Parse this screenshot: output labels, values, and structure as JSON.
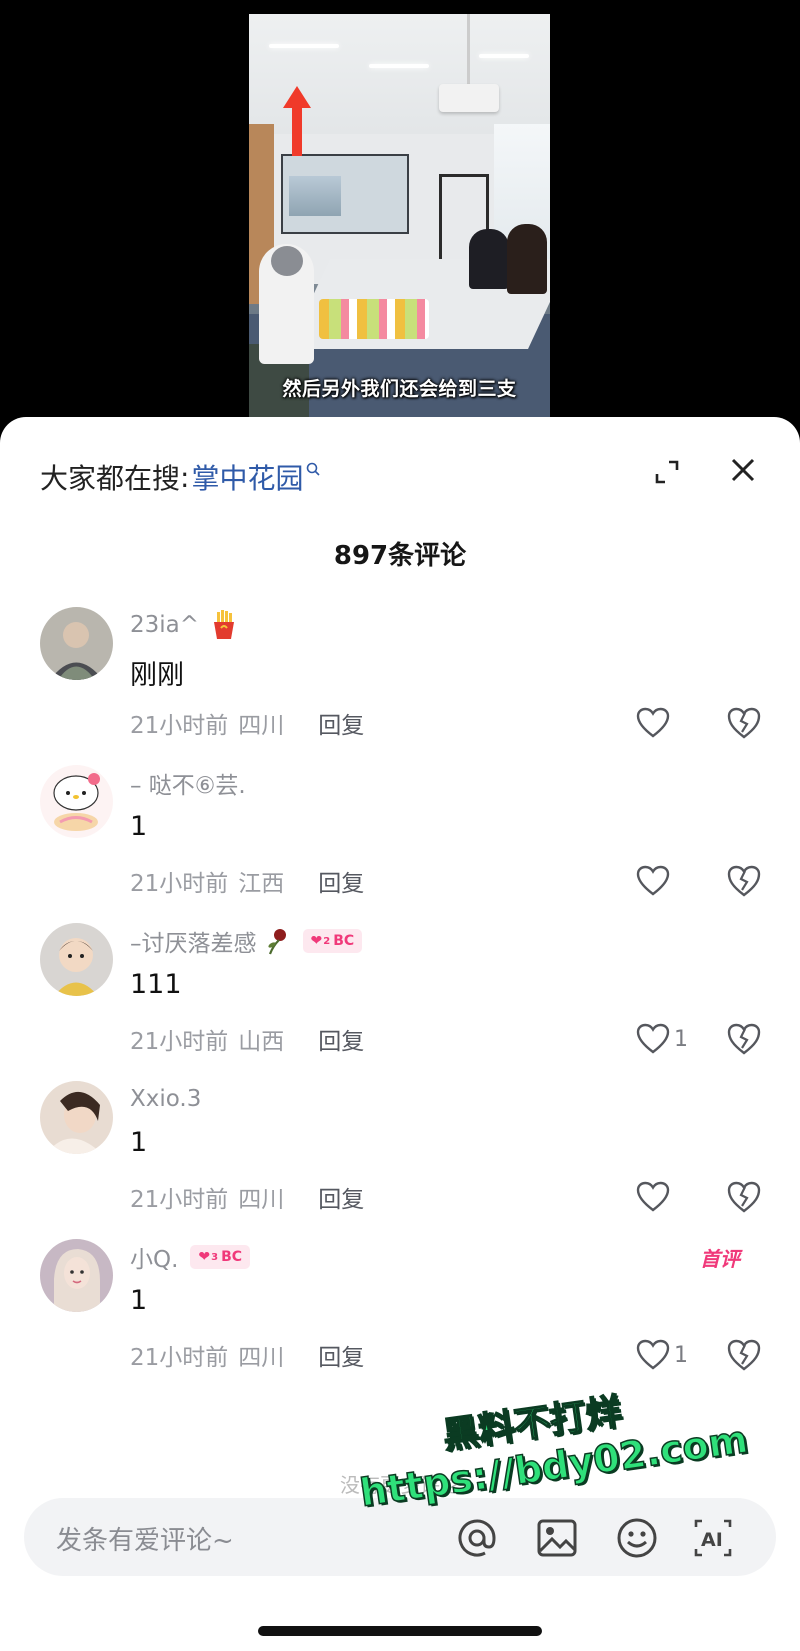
{
  "video": {
    "subtitle": "然后另外我们还会给到三支"
  },
  "sheet": {
    "search_prefix": "大家都在搜",
    "search_colon": ":",
    "search_keyword": "掌中花园",
    "comment_count_label": "897条评论"
  },
  "comments": [
    {
      "username": "23ia^",
      "badge_icon": "french-fries-icon",
      "text": "刚刚",
      "time": "21小时前",
      "location": "四川",
      "reply": "回复",
      "likes": ""
    },
    {
      "username": "– 哒不⑥芸.",
      "text": "1",
      "time": "21小时前",
      "location": "江西",
      "reply": "回复",
      "likes": ""
    },
    {
      "username": "–讨厌落差感",
      "badge_icon": "wilted-rose-icon",
      "level": "BC",
      "level_num": "2",
      "text": "111",
      "time": "21小时前",
      "location": "山西",
      "reply": "回复",
      "likes": "1"
    },
    {
      "username": "Xxio.3",
      "text": "1",
      "time": "21小时前",
      "location": "四川",
      "reply": "回复",
      "likes": ""
    },
    {
      "username": "小Q.",
      "level": "BC",
      "level_num": "3",
      "tag": "首评",
      "text": "1",
      "time": "21小时前",
      "location": "四川",
      "reply": "回复",
      "likes": "1"
    }
  ],
  "more_hint": "没有更多评论",
  "input": {
    "placeholder": "发条有爱评论~"
  },
  "watermark": {
    "line1": "黑料不打烊",
    "line2": "https://bdy02.com"
  },
  "colors": {
    "link_blue": "#2f5aa8",
    "badge_pink": "#f0397a",
    "watermark_green": "#2fe07a"
  }
}
